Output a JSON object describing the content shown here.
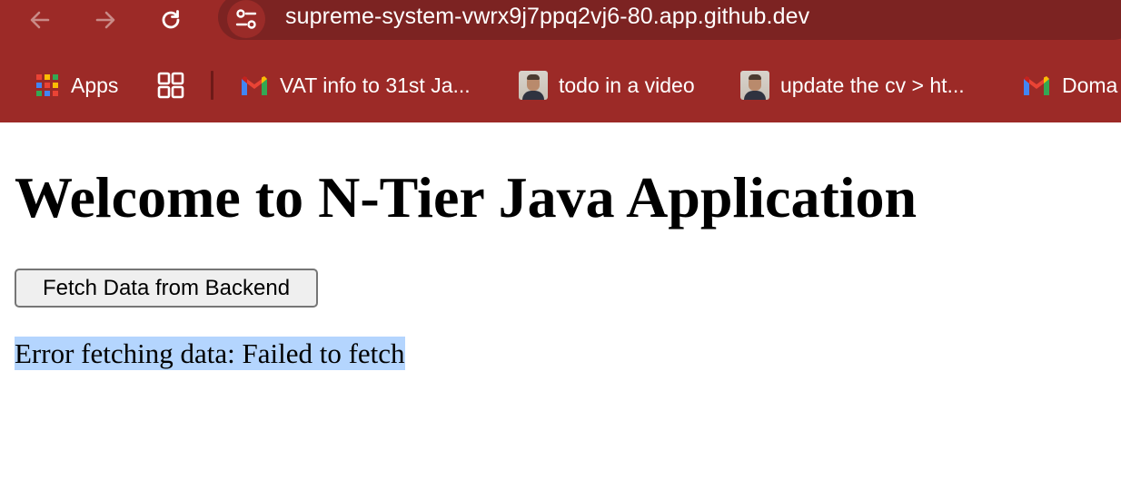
{
  "browser": {
    "url": "supreme-system-vwrx9j7ppq2vj6-80.app.github.dev",
    "theme_color": "#9c2a27",
    "nav": {
      "back_icon": "arrow-left-icon",
      "forward_icon": "arrow-right-icon",
      "reload_icon": "reload-icon",
      "site_info_icon": "tune-icon"
    },
    "bookmarks": [
      {
        "label": "Apps",
        "icon": "apps-grid-icon"
      },
      {
        "label": "",
        "icon": "tab-groups-icon"
      },
      {
        "label": "VAT info to 31st Ja...",
        "icon": "gmail-icon"
      },
      {
        "label": "todo in a video",
        "icon": "avatar-icon"
      },
      {
        "label": "update the cv > ht...",
        "icon": "avatar-icon"
      },
      {
        "label": "Doma",
        "icon": "gmail-icon"
      }
    ]
  },
  "page": {
    "heading": "Welcome to N-Tier Java Application",
    "fetch_button_label": "Fetch Data from Backend",
    "status_message": "Error fetching data: Failed to fetch",
    "selection_color": "#b4d5fe"
  }
}
